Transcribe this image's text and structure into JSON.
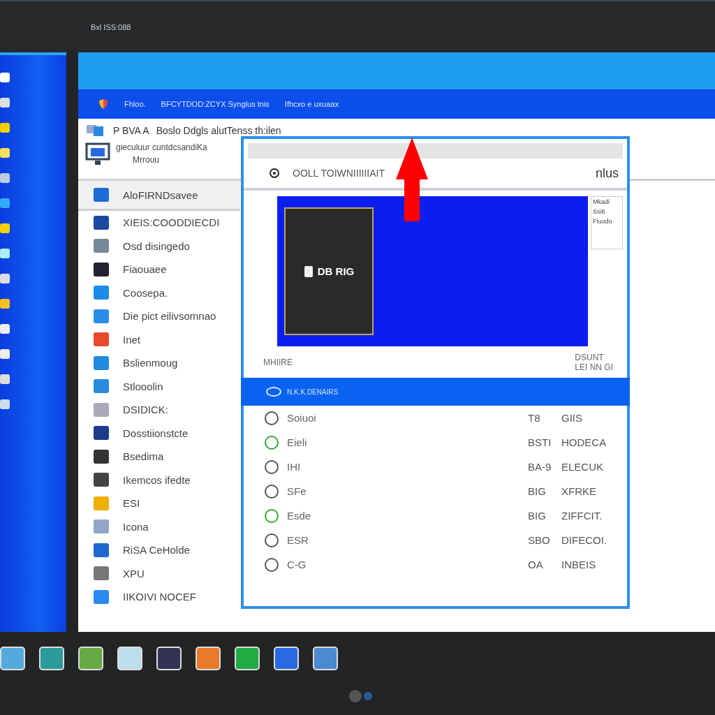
{
  "top_bar": {
    "title": "Bxl ISS:088"
  },
  "window": {
    "header": {
      "texts": [
        "Fhloo.",
        "BFCYTDOD:ZCYX Synglus tnis",
        "Ifhcxo e uxuaax"
      ]
    },
    "toolbar": {
      "label": "P BVA A",
      "path": "Boslo Ddgls alutTenss th:ilen",
      "subtitle": "gieculuur cuntdcsandiKa",
      "subtitle_2": "Mrrouu"
    },
    "sidebar": {
      "items": [
        {
          "label": "AloFIRNDsavee",
          "selected": true
        },
        {
          "label": "XIEIS:COODDIECDI",
          "selected": false
        },
        {
          "label": "Osd disingedo",
          "selected": false
        },
        {
          "label": "Fiaouaee",
          "selected": false
        },
        {
          "label": "Coosepa.",
          "selected": false
        },
        {
          "label": "Die pict eilivsomnao",
          "selected": false
        },
        {
          "label": "Inet",
          "selected": false
        },
        {
          "label": "Bslienmoug",
          "selected": false
        },
        {
          "label": "Stlooolin",
          "selected": false
        },
        {
          "label": "DSIDICK:",
          "selected": false
        },
        {
          "label": "Dosstiionstcte",
          "selected": false
        },
        {
          "label": "Bsedima",
          "selected": false
        },
        {
          "label": "Ikemcos ifedte",
          "selected": false
        },
        {
          "label": "ESI",
          "selected": false
        },
        {
          "label": "Icona",
          "selected": false
        },
        {
          "label": "RiSA CeHolde",
          "selected": false
        },
        {
          "label": "XPU",
          "selected": false
        },
        {
          "label": "IIKOIVI NOCEF",
          "selected": false
        }
      ]
    }
  },
  "dialog": {
    "title": "OOLL TOIWNIIIIIIAIT",
    "action": "nlus",
    "preview": {
      "label": "DB RIG",
      "side_texts": [
        "Mkadi",
        "Ssi6",
        "Fiuodo"
      ]
    },
    "footer": {
      "left": "MHIIRE",
      "right": [
        "DSUNT",
        "LEI NN GI"
      ]
    },
    "bar": {
      "text": "N.K.K.DENAIRS"
    },
    "rows": [
      {
        "name": "Soiuoi",
        "code": "T8",
        "value": "GIIS"
      },
      {
        "name": "Eieli",
        "code": "BSTI",
        "value": "HODECA"
      },
      {
        "name": "IHI",
        "code": "BA-9",
        "value": "ELECUK"
      },
      {
        "name": "SFe",
        "code": "BIG",
        "value": "XFRKE"
      },
      {
        "name": "Esde",
        "code": "BIG",
        "value": "ZIFFCIT."
      },
      {
        "name": "ESR",
        "code": "SBO",
        "value": "DIFECOI."
      },
      {
        "name": "C-G",
        "code": "OA",
        "value": "INBEIS"
      }
    ]
  }
}
